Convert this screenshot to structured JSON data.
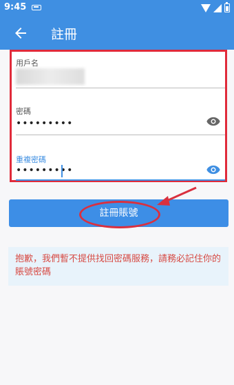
{
  "status_bar": {
    "time": "9:45"
  },
  "app_bar": {
    "title": "註冊"
  },
  "form": {
    "username": {
      "label": "用戶名",
      "value": ""
    },
    "password": {
      "label": "密碼",
      "value": "•••••••••"
    },
    "confirm_password": {
      "label": "重複密碼",
      "value": "•••••••••"
    }
  },
  "register_button": {
    "label": "註冊賬號"
  },
  "notice": {
    "text": "抱歉，我們暫不提供找回密碼服務，請務必記住你的賬號密碼"
  },
  "colors": {
    "primary": "#3f8fe2",
    "annotation_red": "#e02a3a",
    "notice_text": "#d74a43",
    "notice_bg": "#e8f3fb"
  },
  "icons": [
    "back-arrow-icon",
    "eye-icon",
    "wifi-icon",
    "signal-icon",
    "battery-icon",
    "notification-icon"
  ]
}
